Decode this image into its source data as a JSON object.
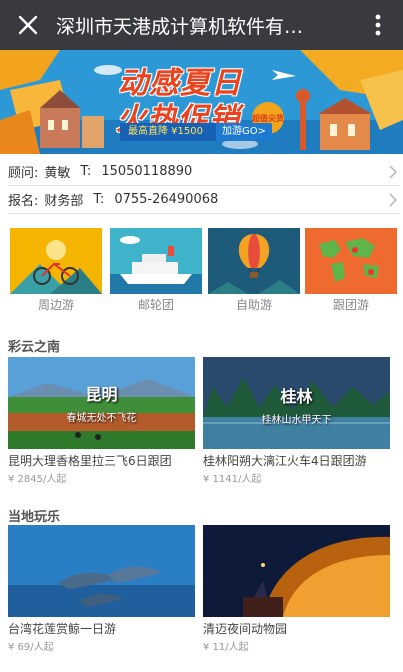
{
  "header": {
    "title": "深圳市天港成计算机软件有…"
  },
  "banner": {
    "title_line1": "动感夏日",
    "title_line2": "火热促销",
    "price_text": "最高直降 ¥1500",
    "cta": "加游GO>",
    "badge": "超值尖货",
    "accent_color": "#e9431f"
  },
  "contacts": [
    {
      "label": "顾问:",
      "name": "黄敏",
      "phone_label": "T:",
      "phone": "15050118890"
    },
    {
      "label": "报名:",
      "name": "财务部",
      "phone_label": "T:",
      "phone": "0755-26490068"
    }
  ],
  "categories": [
    {
      "label": "周边游",
      "icon": "bicycle-icon"
    },
    {
      "label": "邮轮团",
      "icon": "cruise-ship-icon"
    },
    {
      "label": "自助游",
      "icon": "hot-air-balloon-icon"
    },
    {
      "label": "跟团游",
      "icon": "world-map-icon"
    }
  ],
  "sections": [
    {
      "title": "彩云之南",
      "items": [
        {
          "title": "昆明大理香格里拉三飞6日跟团",
          "price": "¥ 2845/人起",
          "overlay_title": "昆明",
          "overlay_sub": "春城无处不飞花"
        },
        {
          "title": "桂林阳朔大漓江火车4日跟团游",
          "price": "¥ 1141/人起",
          "overlay_title": "桂林",
          "overlay_sub": "桂林山水甲天下"
        }
      ]
    },
    {
      "title": "当地玩乐",
      "items": [
        {
          "title": "台湾花莲赏鲸一日游",
          "price": "¥ 69/人起"
        },
        {
          "title": "清迈夜间动物园",
          "price": "¥ 11/人起"
        }
      ]
    }
  ]
}
